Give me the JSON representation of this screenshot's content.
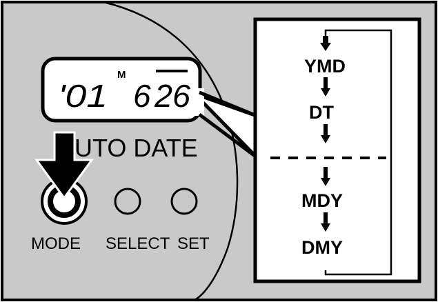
{
  "lcd": {
    "year": "'01",
    "month_mark": "M",
    "month": "6",
    "day": "26"
  },
  "camera_labels": {
    "auto_date": "AUTO DATE",
    "mode": "MODE",
    "select": "SELECT",
    "set": "SET"
  },
  "sequence": {
    "top_items": [
      "YMD",
      "DT"
    ],
    "bottom_items": [
      "MDY",
      "DMY"
    ]
  },
  "colors": {
    "body_gray": "#c9c9c9",
    "lcd_fill": "#ffffff",
    "outline": "#000000"
  }
}
